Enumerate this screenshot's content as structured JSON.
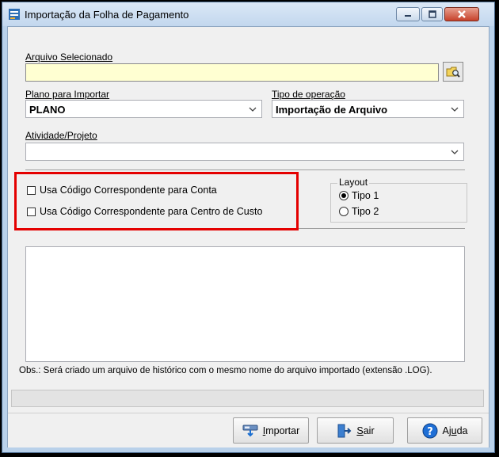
{
  "window": {
    "title": "Importação da Folha de Pagamento"
  },
  "fields": {
    "arquivo_label": "Arquivo Selecionado",
    "arquivo_value": "",
    "plano_label": "Plano para Importar",
    "plano_value": "PLANO",
    "tipo_label": "Tipo de operação",
    "tipo_value": "Importação de Arquivo",
    "atividade_label": "Atividade/Projeto",
    "atividade_value": ""
  },
  "options": {
    "conta_label": "Usa Código Correspondente para Conta",
    "centro_label": "Usa Código Correspondente para Centro de Custo"
  },
  "layout_group": {
    "legend": "Layout",
    "tipo1": "Tipo 1",
    "tipo2": "Tipo 2",
    "selected": "Tipo 1"
  },
  "obs": "Obs.: Será criado um arquivo de histórico com o mesmo nome do arquivo importado (extensão .LOG).",
  "buttons": {
    "importar": {
      "pre": "",
      "key": "I",
      "post": "mportar"
    },
    "sair": {
      "pre": "",
      "key": "S",
      "post": "air"
    },
    "ajuda": {
      "pre": "Aj",
      "key": "u",
      "post": "da"
    }
  },
  "colors": {
    "highlight": "#e40000",
    "file_field_bg": "#ffffd2",
    "window_frame": "#b9d1ea"
  }
}
